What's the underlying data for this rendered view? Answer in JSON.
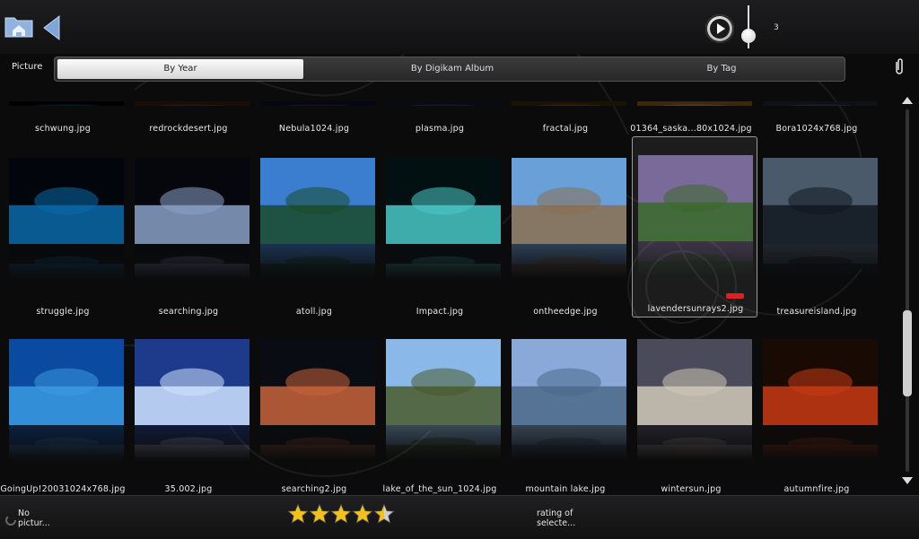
{
  "topbar": {
    "home_icon": "home-folder-icon",
    "back_icon": "back-arrow-icon",
    "play_icon": "play-icon",
    "zoom_value": "3"
  },
  "tabs": {
    "label": "Picture",
    "items": [
      "By Year",
      "By Digikam Album",
      "By Tag"
    ],
    "active_index": 0
  },
  "grid": {
    "row0": [
      "schwung.jpg",
      "redrockdesert.jpg",
      "Nebula1024.jpg",
      "plasma.jpg",
      "fractal.jpg",
      "01364_saska...80x1024.jpg",
      "Bora1024x768.jpg"
    ],
    "row1": [
      "struggle.jpg",
      "searching.jpg",
      "atoll.jpg",
      "Impact.jpg",
      "ontheedge.jpg",
      "lavendersunrays2.jpg",
      "treasureisland.jpg"
    ],
    "row2": [
      "GoingUp!20031024x768.jpg",
      "35.002.jpg",
      "searching2.jpg",
      "lake_of_the_sun_1024.jpg",
      "mountain lake.jpg",
      "wintersun.jpg",
      "autumnfire.jpg"
    ],
    "selected": "lavendersunrays2.jpg"
  },
  "statusbar": {
    "left_line1": "No",
    "left_line2": "pictur...",
    "rating": 4.5,
    "rating_max": 5,
    "right_line1": "rating of",
    "right_line2": "selecte..."
  },
  "colors": {
    "background": "#0b0b0c",
    "star": "#f2c21b",
    "tag": "#e02020"
  }
}
